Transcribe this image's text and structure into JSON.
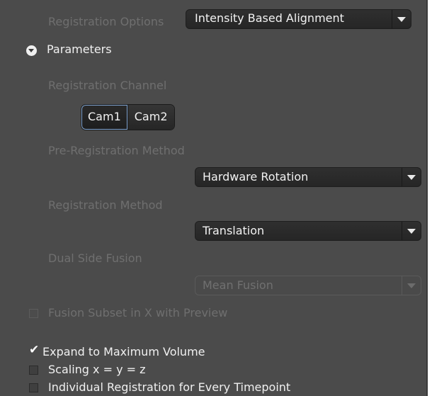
{
  "registration_options": {
    "label": "Registration Options",
    "value": "Intensity Based Alignment"
  },
  "parameters": {
    "label": "Parameters",
    "icon": "collapse-circle-icon"
  },
  "registration_channel": {
    "label": "Registration Channel",
    "options": [
      "Cam1",
      "Cam2"
    ],
    "selected": "Cam1"
  },
  "pre_registration": {
    "label": "Pre-Registration Method",
    "value": "Hardware Rotation"
  },
  "registration_method": {
    "label": "Registration Method",
    "value": "Translation"
  },
  "dual_side_fusion": {
    "label": "Dual Side Fusion",
    "value": "Mean Fusion"
  },
  "checkboxes": {
    "fusion_subset": {
      "label": "Fusion Subset in X with Preview",
      "checked": false,
      "enabled": false
    },
    "expand_max": {
      "label": "Expand to Maximum Volume",
      "checked": true,
      "enabled": true
    },
    "scaling": {
      "label": "Scaling x = y = z",
      "checked": false,
      "enabled": true
    },
    "individual": {
      "label": "Individual Registration for Every Timepoint",
      "checked": false,
      "enabled": true
    }
  },
  "colors": {
    "panel_bg": "#4b4b4b",
    "selected_outline": "#7fa3d0"
  }
}
